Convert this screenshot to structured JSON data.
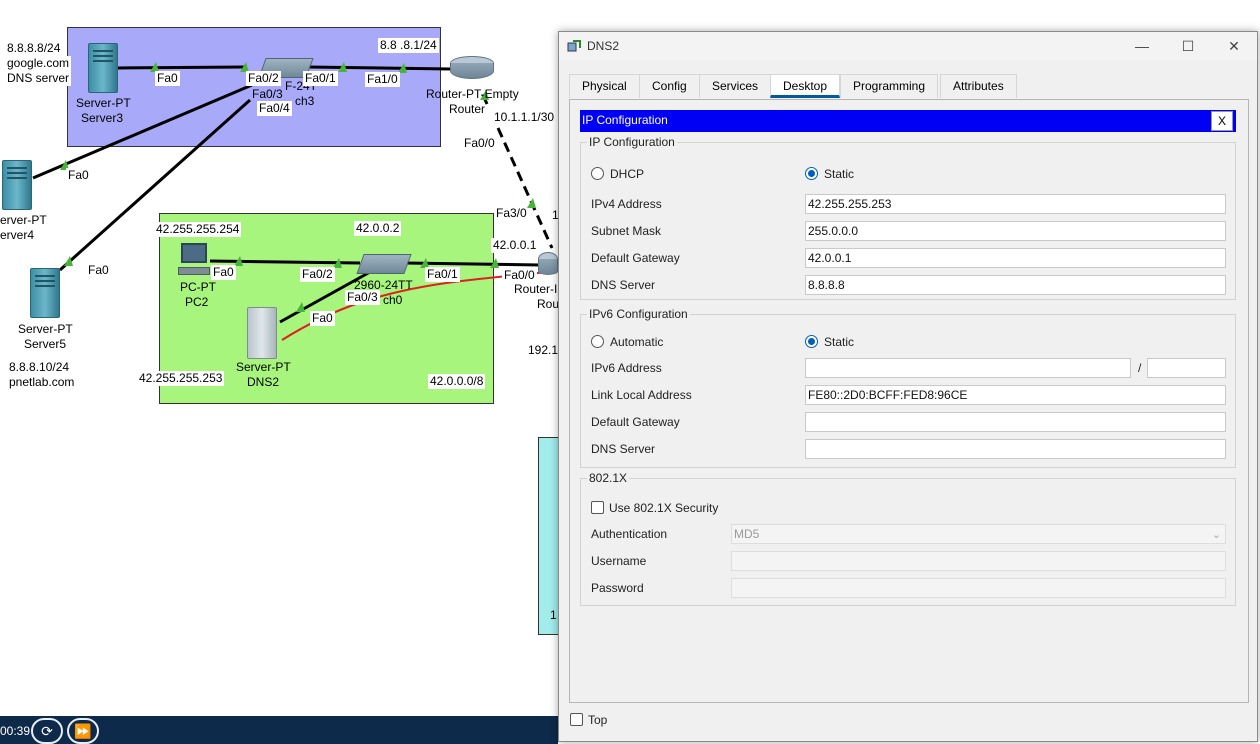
{
  "topology": {
    "labels": {
      "server3_ip": "8.8.8.8/24",
      "server3_host": "google.com",
      "server3_role": "DNS server",
      "server3_type": "Server-PT",
      "server3_name": "Server3",
      "fa0_server3": "Fa0",
      "sw3_fa02": "Fa0/2",
      "sw3_fa03": "Fa0/3",
      "sw3_fa04": "Fa0/4",
      "sw3_fa01": "Fa0/1",
      "sw3_partial": "F-24T",
      "sw3_name_partial": "ch3",
      "router_fa10": "Fa1/0",
      "router_net_top": "8.8 .8.1/24",
      "router_model": "Router-PT-Empty",
      "router_name": "Router",
      "link_ip": "10.1.1.1/30",
      "router_fa00": "Fa0/0",
      "server4_type": "erver-PT",
      "server4_name": "erver4",
      "fa0_server4": "Fa0",
      "fa0_server5": "Fa0",
      "server5_type": "Server-PT",
      "server5_name": "Server5",
      "server5_ip": "8.8.8.10/24",
      "server5_host": "pnetlab.com",
      "pc2_ip": "42.255.255.254",
      "pc2_type": "PC-PT",
      "pc2_name": "PC2",
      "pc2_fa0": "Fa0",
      "sw_ip": "42.0.0.2",
      "sw_fa02": "Fa0/2",
      "sw_fa01": "Fa0/1",
      "sw_fa03": "Fa0/3",
      "sw_model": "2960-24TT",
      "sw_name_partial": "ch0",
      "dns2_fa0": "Fa0",
      "dns2_type": "Server-PT",
      "dns2_name": "DNS2",
      "dns2_ip": "42.255.255.253",
      "net": "42.0.0.0/8",
      "r2_fa30": "Fa3/0",
      "r2_ip": "42.0.0.1",
      "r2_fa00": "Fa0/0",
      "r2_model_partial": "Router-I",
      "r2_name_partial": "Rou",
      "r2_net_partial": "192.1",
      "partial_1": "1",
      "partial_2": "1"
    }
  },
  "timebar": {
    "time": "00:39",
    "reset_icon": "reset-simulation-icon",
    "fast_icon": "fast-forward-icon"
  },
  "window": {
    "title": "DNS2",
    "minimize": "—",
    "maximize": "☐",
    "close": "✕",
    "tabs": [
      "Physical",
      "Config",
      "Services",
      "Desktop",
      "Programming",
      "Attributes"
    ],
    "active_tab": "Desktop",
    "ip_config_bar": "IP Configuration",
    "ip_config_close": "X",
    "ipv4": {
      "group_title": "IP Configuration",
      "dhcp_label": "DHCP",
      "static_label": "Static",
      "mode": "Static",
      "address_label": "IPv4 Address",
      "address": "42.255.255.253",
      "mask_label": "Subnet Mask",
      "mask": "255.0.0.0",
      "gateway_label": "Default Gateway",
      "gateway": "42.0.0.1",
      "dns_label": "DNS Server",
      "dns": "8.8.8.8"
    },
    "ipv6": {
      "group_title": "IPv6 Configuration",
      "auto_label": "Automatic",
      "static_label": "Static",
      "mode": "Static",
      "address_label": "IPv6 Address",
      "address": "",
      "slash": "/",
      "prefix": "",
      "link_local_label": "Link Local Address",
      "link_local": "FE80::2D0:BCFF:FED8:96CE",
      "gateway_label": "Default Gateway",
      "gateway": "",
      "dns_label": "DNS Server",
      "dns": ""
    },
    "dot1x": {
      "group_title": "802.1X",
      "use_label": "Use 802.1X Security",
      "auth_label": "Authentication",
      "auth_value": "MD5",
      "user_label": "Username",
      "user_value": "",
      "pass_label": "Password",
      "pass_value": ""
    },
    "top_label": "Top"
  },
  "colors": {
    "area_top": "#a9a9f9",
    "area_lan": "#a7f57d",
    "area_right": "#a2ecec",
    "ip_bar": "#0000f5",
    "link_up": "#49b43b",
    "annotation": "#e02020",
    "radio_on": "#005fb8"
  }
}
